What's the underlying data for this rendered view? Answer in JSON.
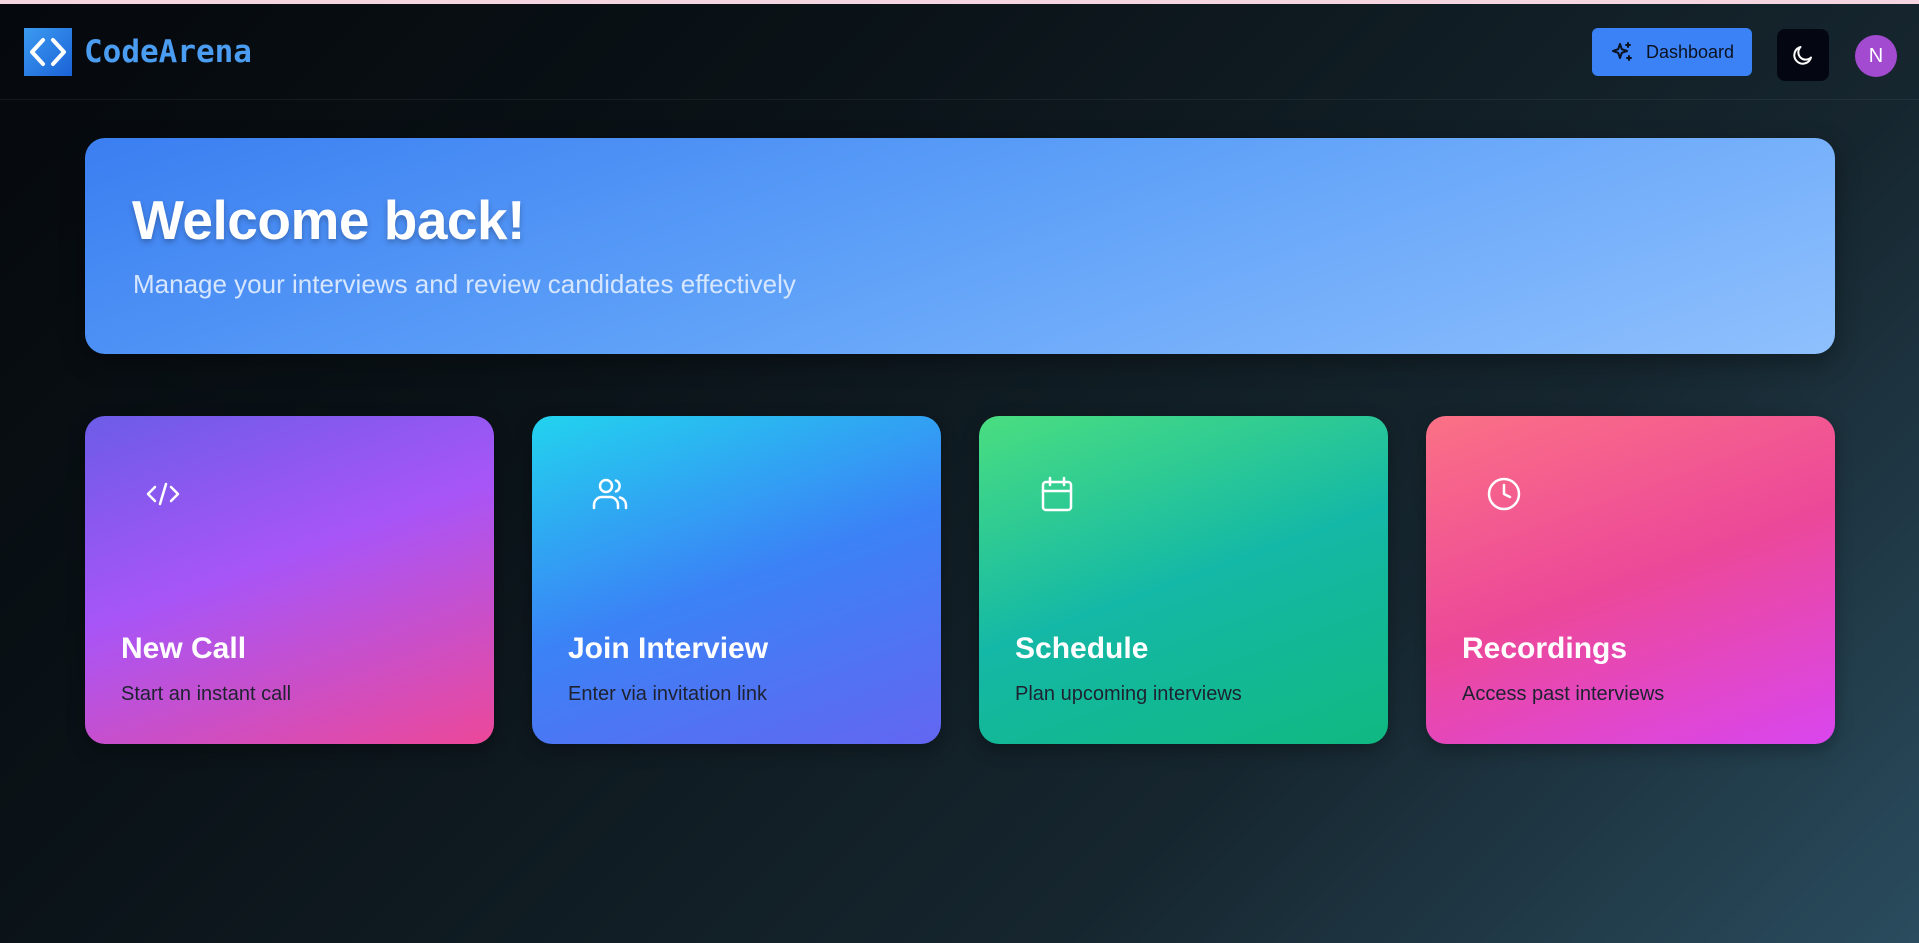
{
  "app": {
    "name": "CodeArena"
  },
  "header": {
    "dashboard_label": "Dashboard",
    "dashboard_icon": "sparkles-icon",
    "theme_icon": "moon-icon",
    "avatar_initial": "N"
  },
  "welcome": {
    "title": "Welcome back!",
    "subtitle": "Manage your interviews and review candidates effectively"
  },
  "actions": [
    {
      "title": "New Call",
      "description": "Start an instant call",
      "icon": "code-icon"
    },
    {
      "title": "Join Interview",
      "description": "Enter via invitation link",
      "icon": "users-icon"
    },
    {
      "title": "Schedule",
      "description": "Plan upcoming interviews",
      "icon": "calendar-icon"
    },
    {
      "title": "Recordings",
      "description": "Access past interviews",
      "icon": "clock-icon"
    }
  ],
  "colors": {
    "accent": "#3b82f6",
    "avatar": "#a24bd1"
  }
}
